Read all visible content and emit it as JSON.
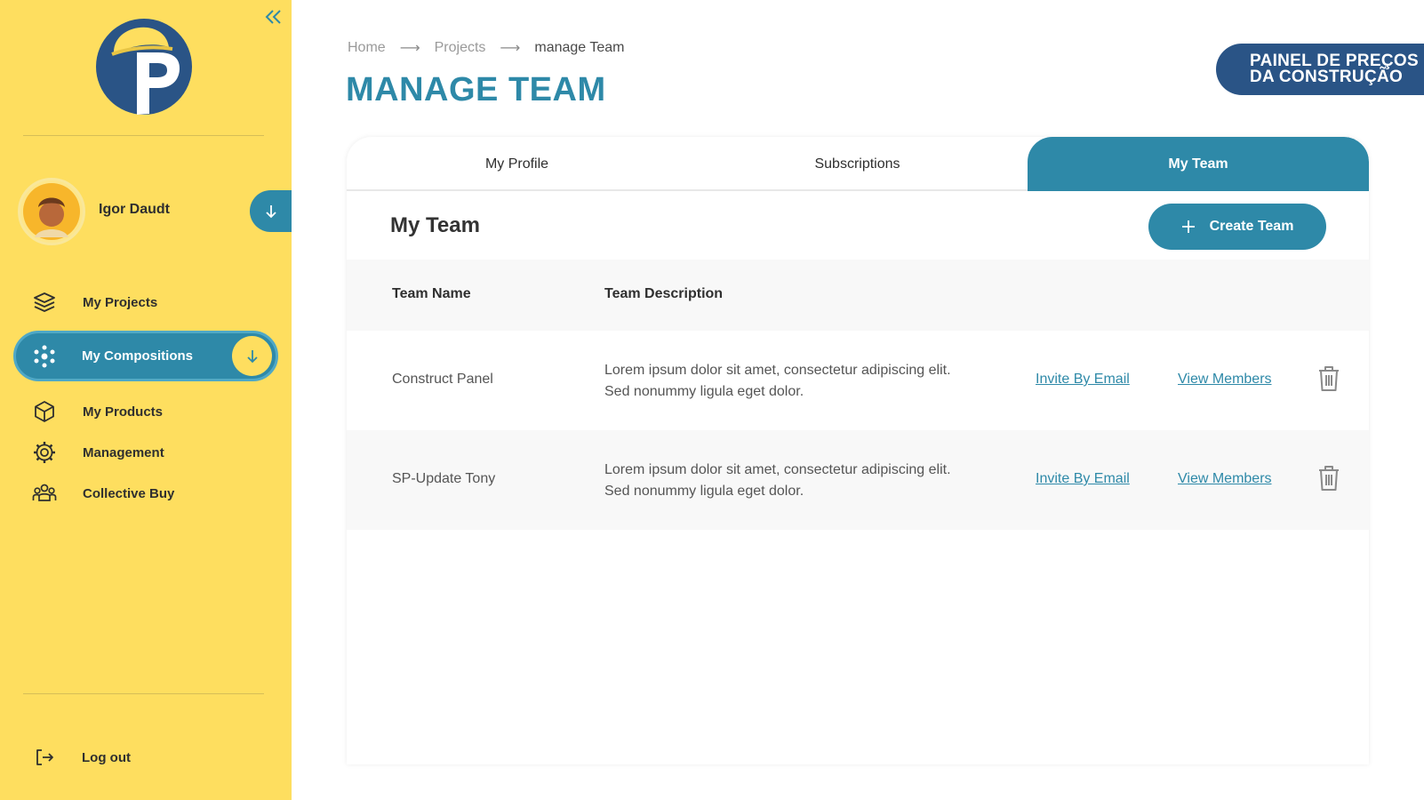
{
  "sidebar": {
    "collapse_icon": "double-chevron-left-icon",
    "logo_icon": "painel-logo-icon",
    "user": {
      "name": "Igor Daudt",
      "toggle_icon": "arrow-down-icon"
    },
    "items": [
      {
        "label": "My Projects",
        "icon": "layers-icon"
      },
      {
        "label": "My Compositions",
        "icon": "molecule-icon",
        "active": true
      },
      {
        "label": "My Products",
        "icon": "box-icon"
      },
      {
        "label": "Management",
        "icon": "gear-icon"
      },
      {
        "label": "Collective Buy",
        "icon": "people-icon"
      }
    ],
    "logout_label": "Log out"
  },
  "breadcrumb": [
    "Home",
    "Projects",
    "manage Team"
  ],
  "page_title": "MANAGE TEAM",
  "brand_badge": {
    "line1": "PAINEL DE PREÇOS",
    "line2": "DA CONSTRUÇÃO"
  },
  "tabs": [
    {
      "label": "My Profile"
    },
    {
      "label": "Subscriptions"
    },
    {
      "label": "My Team",
      "active": true
    }
  ],
  "section_title": "My Team",
  "create_button_label": "Create Team",
  "table": {
    "headers": [
      "Team Name",
      "Team Description"
    ],
    "rows": [
      {
        "name": "Construct Panel",
        "description": "Lorem ipsum dolor sit amet, consectetur adipiscing elit. Sed nonummy ligula eget dolor.",
        "invite_label": "Invite By Email",
        "view_label": "View Members"
      },
      {
        "name": "SP-Update Tony",
        "description": "Lorem ipsum dolor sit amet, consectetur adipiscing elit. Sed nonummy ligula eget dolor.",
        "invite_label": "Invite By Email",
        "view_label": "View Members"
      }
    ]
  },
  "colors": {
    "sidebar_bg": "#fede5f",
    "accent": "#2e89a8",
    "brand_navy": "#2a5486"
  }
}
